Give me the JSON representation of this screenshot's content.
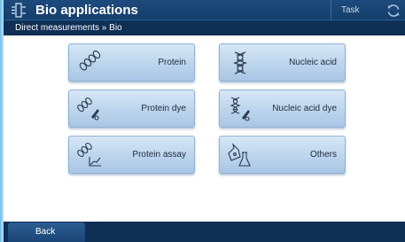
{
  "header": {
    "title": "Bio applications",
    "task_label": "Task"
  },
  "breadcrumb": "Direct measurements » Bio",
  "apps": [
    {
      "label": "Protein",
      "icon": "protein-icon"
    },
    {
      "label": "Nucleic acid",
      "icon": "dna-icon"
    },
    {
      "label": "Protein dye",
      "icon": "protein-dye-icon"
    },
    {
      "label": "Nucleic acid dye",
      "icon": "nucleic-acid-dye-icon"
    },
    {
      "label": "Protein assay",
      "icon": "protein-assay-icon"
    },
    {
      "label": "Others",
      "icon": "flasks-icon"
    }
  ],
  "footer": {
    "back_label": "Back"
  },
  "colors": {
    "header_bg": "#153f6c",
    "breadcrumb_bg": "#0f2f55",
    "button_top": "#d7e7f7",
    "button_bottom": "#a9c6e5",
    "label_text": "#1c2b3d"
  }
}
